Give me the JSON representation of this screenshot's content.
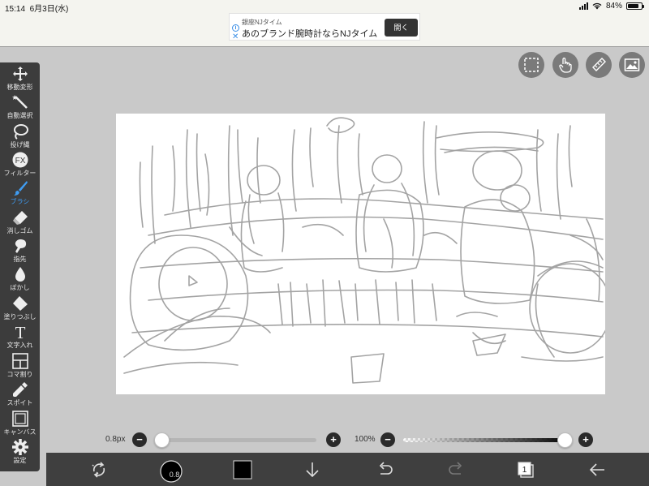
{
  "status_bar": {
    "time": "15:14",
    "date": "6月3日(水)",
    "battery": "84%"
  },
  "ad": {
    "sponsor": "銀座NJタイム",
    "headline": "あのブランド腕時計ならNJタイム",
    "button": "開く"
  },
  "toolbar": {
    "items": [
      {
        "label": "移動変形",
        "icon": "move-icon"
      },
      {
        "label": "自動選択",
        "icon": "magic-wand-icon"
      },
      {
        "label": "投げ縄",
        "icon": "lasso-icon"
      },
      {
        "label": "フィルター",
        "icon": "fx-icon",
        "glyph": "FX"
      },
      {
        "label": "ブラシ",
        "icon": "brush-icon",
        "active": true
      },
      {
        "label": "消しゴム",
        "icon": "eraser-icon"
      },
      {
        "label": "指先",
        "icon": "finger-icon"
      },
      {
        "label": "ぼかし",
        "icon": "blur-icon"
      },
      {
        "label": "塗りつぶし",
        "icon": "bucket-icon"
      },
      {
        "label": "文字入れ",
        "icon": "text-icon",
        "glyph": "T"
      },
      {
        "label": "コマ割り",
        "icon": "panel-icon"
      },
      {
        "label": "スポイト",
        "icon": "eyedropper-icon"
      },
      {
        "label": "キャンバス",
        "icon": "canvas-icon"
      },
      {
        "label": "設定",
        "icon": "gear-icon"
      }
    ],
    "active_color": "#3f9cf2"
  },
  "top_buttons": [
    "selection-icon",
    "hand-touch-icon",
    "ruler-pen-icon",
    "image-icon"
  ],
  "sliders": {
    "brush_size": {
      "value_label": "0.8px",
      "fraction": 0.0
    },
    "opacity": {
      "value_label": "100%",
      "fraction": 1.0
    }
  },
  "bottom_bar": {
    "color_circle_label": "0.8",
    "layer_count": "1",
    "current_color": "#000000",
    "icons": [
      "transform-icon",
      "brush-size-icon",
      "color-swatch-icon",
      "import-arrow-icon",
      "undo-icon",
      "redo-icon",
      "layers-icon",
      "back-icon"
    ]
  }
}
